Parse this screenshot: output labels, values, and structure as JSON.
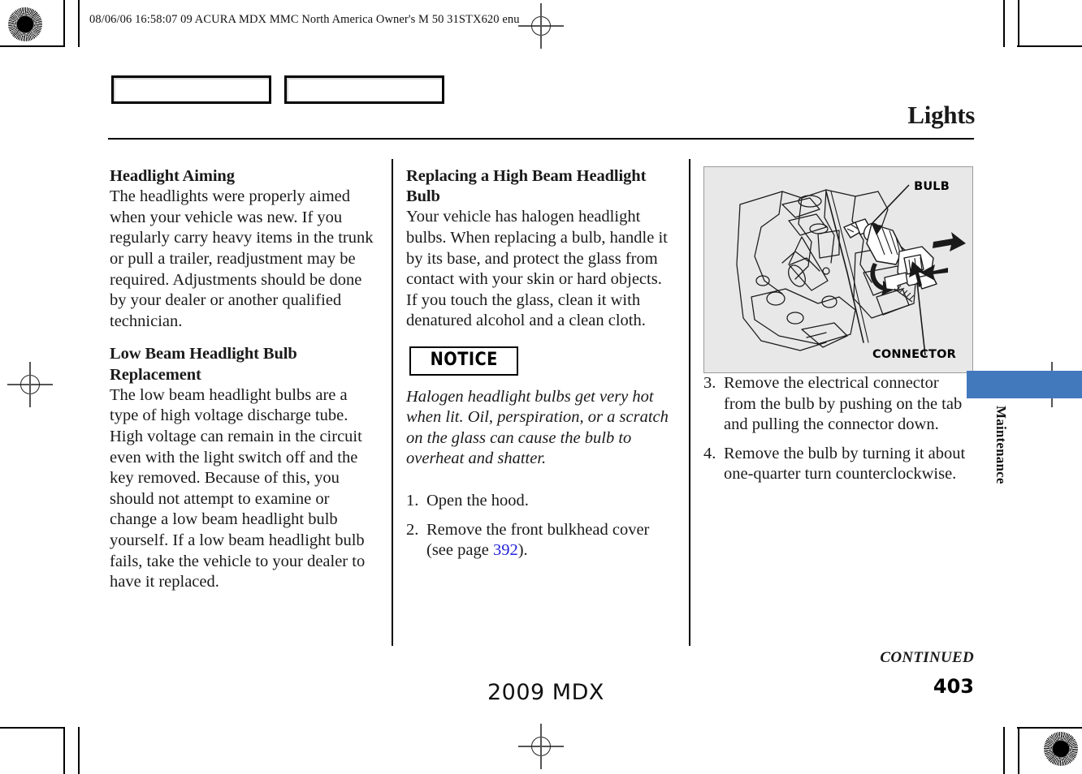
{
  "print_marks": {
    "header_meta": "08/06/06 16:58:07   09 ACURA MDX MMC North America Owner's M 50 31STX620 enu",
    "rosette_icon": "starburst-rosette",
    "registration_icon": "registration-crosshair"
  },
  "header": {
    "title": "Lights"
  },
  "columns": {
    "one": {
      "section_1": {
        "heading": "Headlight Aiming",
        "body": "The headlights were properly aimed when your vehicle was new. If you regularly carry heavy items in the trunk or pull a trailer, readjustment may be required. Adjustments should be done by your dealer or another qualified technician."
      },
      "section_2": {
        "heading": "Low Beam Headlight Bulb Replacement",
        "body": "The low beam headlight bulbs are a type of high voltage discharge tube. High voltage can remain in the circuit even with the light switch off and the key removed. Because of this, you should not attempt to examine or change a low beam headlight bulb yourself. If a low beam headlight bulb fails, take the vehicle to your dealer to have it replaced."
      }
    },
    "two": {
      "section_1": {
        "heading": "Replacing a High Beam Headlight Bulb",
        "body": "Your vehicle has halogen headlight bulbs. When replacing a bulb, handle it by its base, and protect the glass from contact with your skin or hard objects. If you touch the glass, clean it with denatured alcohol and a clean cloth."
      },
      "notice": {
        "badge": "NOTICE",
        "text": "Halogen headlight bulbs get very hot when lit. Oil, perspiration, or a scratch on the glass can cause the bulb to overheat and shatter."
      },
      "steps": [
        {
          "num": "1.",
          "text": "Open the hood."
        },
        {
          "num": "2.",
          "text": "Remove the front bulkhead cover (see page ",
          "xref": "392",
          "text_after": ")."
        }
      ]
    },
    "three": {
      "figure": {
        "label_bulb": "BULB",
        "label_connector": "CONNECTOR",
        "alt": "headlight-assembly-line-drawing"
      },
      "steps": [
        {
          "num": "3.",
          "text": "Remove the electrical connector from the bulb by pushing on the tab and pulling the connector down."
        },
        {
          "num": "4.",
          "text": "Remove the bulb by turning it about one-quarter turn counterclockwise."
        }
      ]
    }
  },
  "side_tab": {
    "label": "Maintenance",
    "color": "#4279BD"
  },
  "footer": {
    "continued": "CONTINUED",
    "model": "2009  MDX",
    "page_number": "403"
  }
}
